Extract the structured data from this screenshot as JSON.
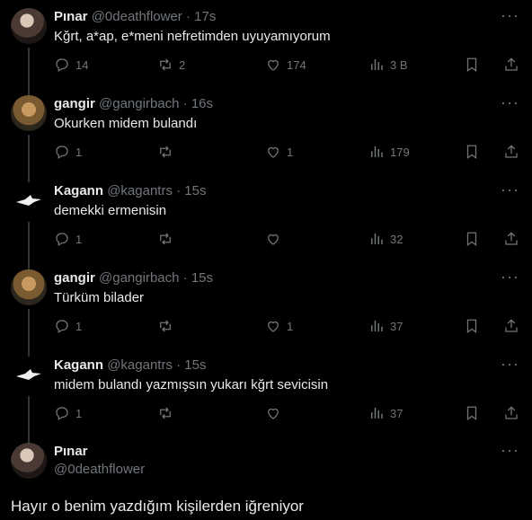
{
  "replies": [
    {
      "name": "Pınar",
      "handle": "@0deathflower",
      "time": "17s",
      "text": "Kğrt, a*ap, e*meni nefretimden uyuyamıyorum",
      "replies": "14",
      "reposts": "2",
      "likes": "174",
      "views": "3 B",
      "avatar": "pinar"
    },
    {
      "name": "gangir",
      "handle": "@gangirbach",
      "time": "16s",
      "text": "Okurken midem bulandı",
      "replies": "1",
      "reposts": "",
      "likes": "1",
      "views": "179",
      "avatar": "gangir"
    },
    {
      "name": "Kagann",
      "handle": "@kagantrs",
      "time": "15s",
      "text": "demekki ermenisin",
      "replies": "1",
      "reposts": "",
      "likes": "",
      "views": "32",
      "avatar": "kagann"
    },
    {
      "name": "gangir",
      "handle": "@gangirbach",
      "time": "15s",
      "text": "Türküm bilader",
      "replies": "1",
      "reposts": "",
      "likes": "1",
      "views": "37",
      "avatar": "gangir"
    },
    {
      "name": "Kagann",
      "handle": "@kagantrs",
      "time": "15s",
      "text": "midem bulandı yazmışsın yukarı kğrt sevicisin",
      "replies": "1",
      "reposts": "",
      "likes": "",
      "views": "37",
      "avatar": "kagann"
    }
  ],
  "main": {
    "name": "Pınar",
    "handle": "@0deathflower",
    "text": "Hayır o benim yazdığım kişilerden iğreniyor",
    "avatar": "pinar"
  },
  "ui": {
    "dot": "·",
    "more": "···"
  }
}
